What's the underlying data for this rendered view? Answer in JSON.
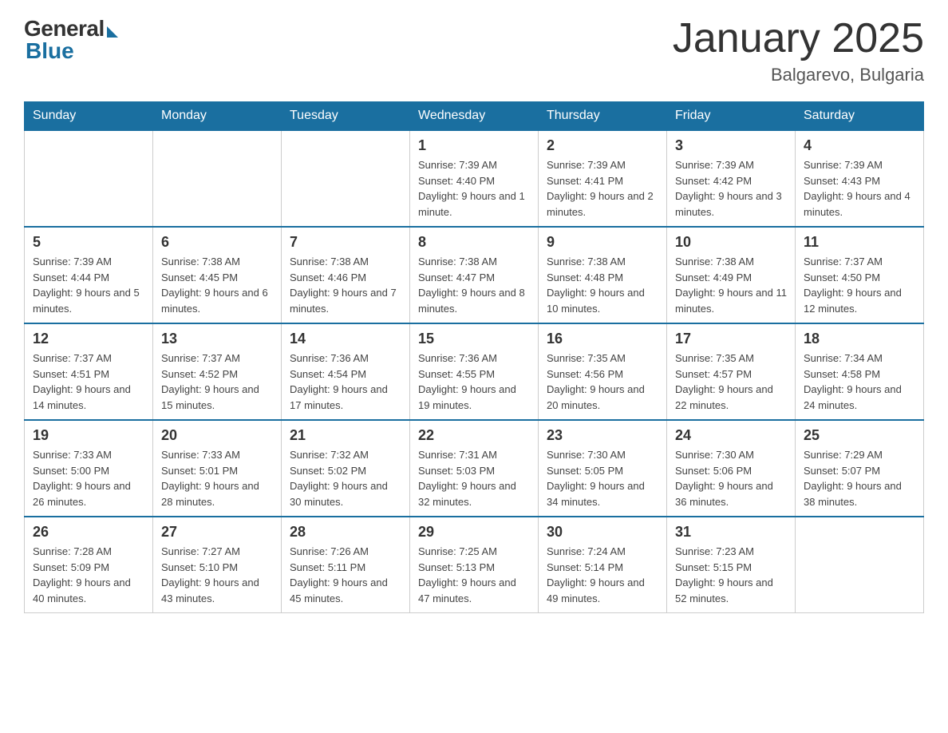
{
  "logo": {
    "general": "General",
    "blue": "Blue"
  },
  "title": "January 2025",
  "location": "Balgarevo, Bulgaria",
  "days_of_week": [
    "Sunday",
    "Monday",
    "Tuesday",
    "Wednesday",
    "Thursday",
    "Friday",
    "Saturday"
  ],
  "weeks": [
    [
      {
        "day": "",
        "info": ""
      },
      {
        "day": "",
        "info": ""
      },
      {
        "day": "",
        "info": ""
      },
      {
        "day": "1",
        "info": "Sunrise: 7:39 AM\nSunset: 4:40 PM\nDaylight: 9 hours and 1 minute."
      },
      {
        "day": "2",
        "info": "Sunrise: 7:39 AM\nSunset: 4:41 PM\nDaylight: 9 hours and 2 minutes."
      },
      {
        "day": "3",
        "info": "Sunrise: 7:39 AM\nSunset: 4:42 PM\nDaylight: 9 hours and 3 minutes."
      },
      {
        "day": "4",
        "info": "Sunrise: 7:39 AM\nSunset: 4:43 PM\nDaylight: 9 hours and 4 minutes."
      }
    ],
    [
      {
        "day": "5",
        "info": "Sunrise: 7:39 AM\nSunset: 4:44 PM\nDaylight: 9 hours and 5 minutes."
      },
      {
        "day": "6",
        "info": "Sunrise: 7:38 AM\nSunset: 4:45 PM\nDaylight: 9 hours and 6 minutes."
      },
      {
        "day": "7",
        "info": "Sunrise: 7:38 AM\nSunset: 4:46 PM\nDaylight: 9 hours and 7 minutes."
      },
      {
        "day": "8",
        "info": "Sunrise: 7:38 AM\nSunset: 4:47 PM\nDaylight: 9 hours and 8 minutes."
      },
      {
        "day": "9",
        "info": "Sunrise: 7:38 AM\nSunset: 4:48 PM\nDaylight: 9 hours and 10 minutes."
      },
      {
        "day": "10",
        "info": "Sunrise: 7:38 AM\nSunset: 4:49 PM\nDaylight: 9 hours and 11 minutes."
      },
      {
        "day": "11",
        "info": "Sunrise: 7:37 AM\nSunset: 4:50 PM\nDaylight: 9 hours and 12 minutes."
      }
    ],
    [
      {
        "day": "12",
        "info": "Sunrise: 7:37 AM\nSunset: 4:51 PM\nDaylight: 9 hours and 14 minutes."
      },
      {
        "day": "13",
        "info": "Sunrise: 7:37 AM\nSunset: 4:52 PM\nDaylight: 9 hours and 15 minutes."
      },
      {
        "day": "14",
        "info": "Sunrise: 7:36 AM\nSunset: 4:54 PM\nDaylight: 9 hours and 17 minutes."
      },
      {
        "day": "15",
        "info": "Sunrise: 7:36 AM\nSunset: 4:55 PM\nDaylight: 9 hours and 19 minutes."
      },
      {
        "day": "16",
        "info": "Sunrise: 7:35 AM\nSunset: 4:56 PM\nDaylight: 9 hours and 20 minutes."
      },
      {
        "day": "17",
        "info": "Sunrise: 7:35 AM\nSunset: 4:57 PM\nDaylight: 9 hours and 22 minutes."
      },
      {
        "day": "18",
        "info": "Sunrise: 7:34 AM\nSunset: 4:58 PM\nDaylight: 9 hours and 24 minutes."
      }
    ],
    [
      {
        "day": "19",
        "info": "Sunrise: 7:33 AM\nSunset: 5:00 PM\nDaylight: 9 hours and 26 minutes."
      },
      {
        "day": "20",
        "info": "Sunrise: 7:33 AM\nSunset: 5:01 PM\nDaylight: 9 hours and 28 minutes."
      },
      {
        "day": "21",
        "info": "Sunrise: 7:32 AM\nSunset: 5:02 PM\nDaylight: 9 hours and 30 minutes."
      },
      {
        "day": "22",
        "info": "Sunrise: 7:31 AM\nSunset: 5:03 PM\nDaylight: 9 hours and 32 minutes."
      },
      {
        "day": "23",
        "info": "Sunrise: 7:30 AM\nSunset: 5:05 PM\nDaylight: 9 hours and 34 minutes."
      },
      {
        "day": "24",
        "info": "Sunrise: 7:30 AM\nSunset: 5:06 PM\nDaylight: 9 hours and 36 minutes."
      },
      {
        "day": "25",
        "info": "Sunrise: 7:29 AM\nSunset: 5:07 PM\nDaylight: 9 hours and 38 minutes."
      }
    ],
    [
      {
        "day": "26",
        "info": "Sunrise: 7:28 AM\nSunset: 5:09 PM\nDaylight: 9 hours and 40 minutes."
      },
      {
        "day": "27",
        "info": "Sunrise: 7:27 AM\nSunset: 5:10 PM\nDaylight: 9 hours and 43 minutes."
      },
      {
        "day": "28",
        "info": "Sunrise: 7:26 AM\nSunset: 5:11 PM\nDaylight: 9 hours and 45 minutes."
      },
      {
        "day": "29",
        "info": "Sunrise: 7:25 AM\nSunset: 5:13 PM\nDaylight: 9 hours and 47 minutes."
      },
      {
        "day": "30",
        "info": "Sunrise: 7:24 AM\nSunset: 5:14 PM\nDaylight: 9 hours and 49 minutes."
      },
      {
        "day": "31",
        "info": "Sunrise: 7:23 AM\nSunset: 5:15 PM\nDaylight: 9 hours and 52 minutes."
      },
      {
        "day": "",
        "info": ""
      }
    ]
  ]
}
